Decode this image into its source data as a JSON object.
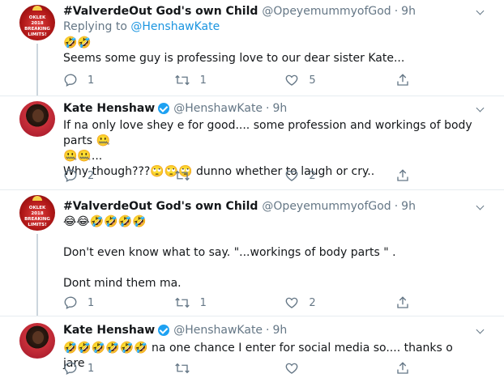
{
  "tweets": [
    {
      "name": "#ValverdeOut God's own Child",
      "handle": "@OpeyemummyofGod",
      "time": "9h",
      "verified": false,
      "replying_prefix": "Replying to ",
      "replying_to": "@HenshawKate",
      "text": "🤣🤣\nSeems some guy is professing love to our dear sister Kate...",
      "replies": "1",
      "retweets": "1",
      "likes": "5"
    },
    {
      "name": "Kate Henshaw",
      "handle": "@HenshawKate",
      "time": "9h",
      "verified": true,
      "text": "If na only love shey e for good.... some profession and workings of body parts 🤐\n🤐🤐...\nWhy though???🙄🙄🙄 dunno whether to laugh or cry..",
      "replies": "2",
      "retweets": "",
      "likes": "2"
    },
    {
      "name": "#ValverdeOut God's own Child",
      "handle": "@OpeyemummyofGod",
      "time": "9h",
      "verified": false,
      "text": "😂😂🤣🤣🤣🤣\n\nDon't even know what to say. \"...workings of body parts \" .\n\nDont mind them ma.",
      "replies": "1",
      "retweets": "1",
      "likes": "2"
    },
    {
      "name": "Kate Henshaw",
      "handle": "@HenshawKate",
      "time": "9h",
      "verified": true,
      "text": "🤣🤣🤣🤣🤣🤣 na one chance I enter for social media so.... thanks o jare",
      "replies": "1",
      "retweets": "",
      "likes": ""
    }
  ],
  "avatar_badge": "OKLEK 2018\nBREAKING\nLIMITS!",
  "icons": {
    "reply": "reply-icon",
    "retweet": "retweet-icon",
    "like": "heart-icon",
    "share": "share-icon",
    "more": "chevron-down-icon",
    "verified": "verified-badge-icon"
  },
  "colors": {
    "link": "#1b95e0",
    "verified": "#1da1f2",
    "muted": "#657786",
    "divider": "#e6ecf0"
  }
}
